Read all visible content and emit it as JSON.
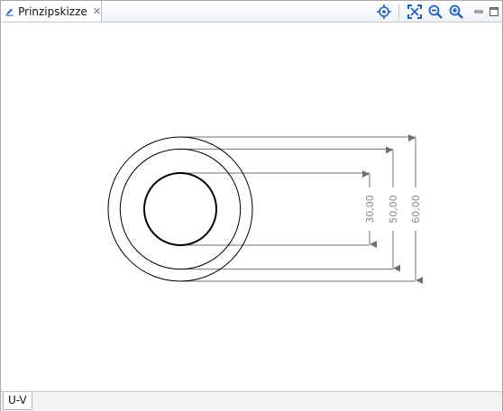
{
  "view": {
    "tab_title": "Prinzipskizze",
    "tab_icon": "pencil-edit-icon",
    "tab_close_icon": "close-icon"
  },
  "toolbar": {
    "items": [
      "target-center-icon",
      "fit-to-screen-icon",
      "zoom-out-icon",
      "zoom-in-icon"
    ],
    "window_controls": [
      "minimize-icon",
      "maximize-icon"
    ]
  },
  "drawing": {
    "circles": [
      {
        "diameter": 60,
        "label": "60,00"
      },
      {
        "diameter": 50,
        "label": "50,00"
      },
      {
        "diameter": 30,
        "label": "30,00"
      }
    ]
  },
  "bottom_tabs": [
    {
      "label": "U-V"
    }
  ],
  "colors": {
    "accent": "#1f5fbf",
    "dimension_line": "#707070",
    "dimension_text": "#888888",
    "circle": "#000000"
  }
}
